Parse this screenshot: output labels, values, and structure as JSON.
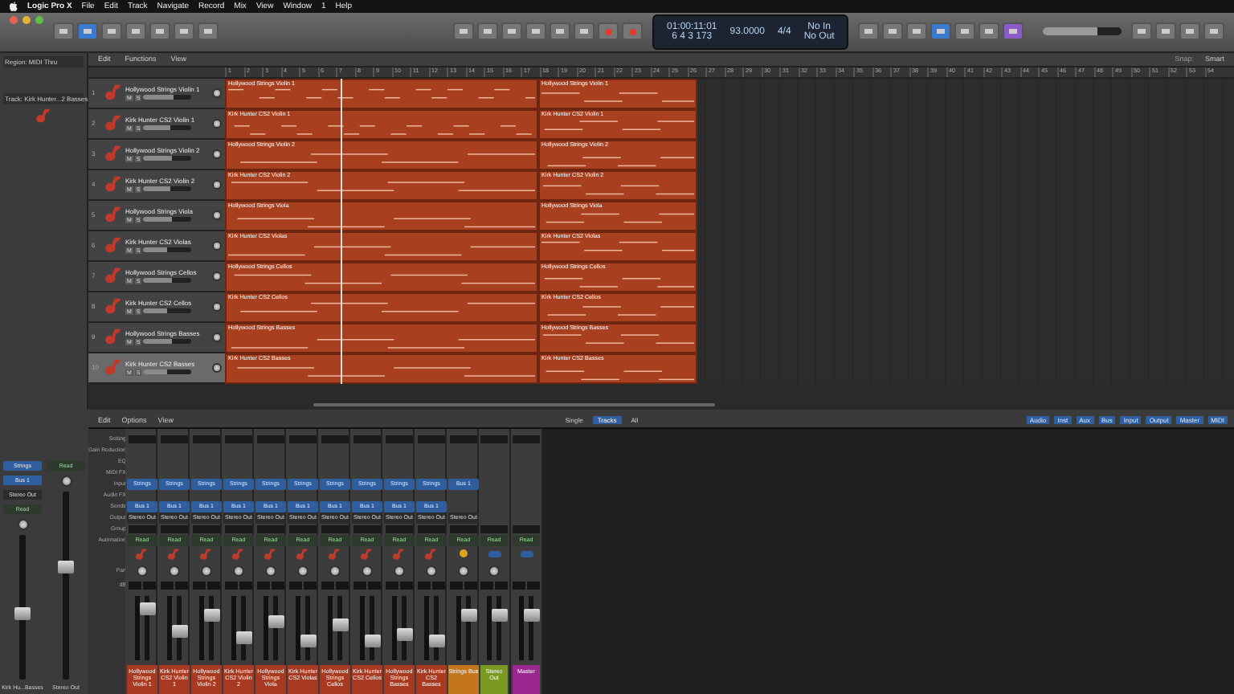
{
  "menu_bar": {
    "app": "Logic Pro X",
    "items": [
      "File",
      "Edit",
      "Track",
      "Navigate",
      "Record",
      "Mix",
      "View",
      "Window",
      "1",
      "Help"
    ]
  },
  "lcd": {
    "time": "01:00:11:01",
    "bars": "6 4 3 173",
    "tempo": "93.0000",
    "signature": "4/4",
    "in": "No In",
    "out": "No Out"
  },
  "control_bar": {
    "master_volume": {
      "level": 0.7
    }
  },
  "inspector": {
    "region_header": "Region: MIDI Thru",
    "track_header": "Track: Kirk Hunter...2 Basses"
  },
  "track_area": {
    "menus": [
      "Edit",
      "Functions",
      "View"
    ],
    "snap_label": "Snap:",
    "snap": "Smart",
    "ruler": [
      "1",
      "2",
      "3",
      "4",
      "5",
      "6",
      "7",
      "8",
      "9",
      "10",
      "11",
      "12",
      "13",
      "14",
      "15",
      "16",
      "17",
      "18",
      "19",
      "20",
      "21",
      "22",
      "23",
      "24",
      "25",
      "26",
      "27",
      "28",
      "29",
      "30",
      "31",
      "32",
      "33",
      "34",
      "35",
      "36",
      "37",
      "38",
      "39",
      "40",
      "41",
      "42",
      "43",
      "44",
      "45",
      "46",
      "47",
      "48",
      "49",
      "50",
      "51",
      "52",
      "53",
      "54"
    ],
    "playhead": {
      "level": 0.115
    }
  },
  "tracks": [
    {
      "number": "1",
      "mute_label": "M",
      "solo_label": "S",
      "name": "Hollywood Strings Violin 1",
      "selected": false,
      "level": 0.62,
      "regions": [
        "Hollywood Strings Violin 1",
        "Hollywood Strings Violin 1"
      ]
    },
    {
      "number": "2",
      "mute_label": "M",
      "solo_label": "S",
      "name": "Kirk Hunter CS2 Violin 1",
      "selected": false,
      "level": 0.55,
      "regions": [
        "Kirk Hunter CS2 Violin 1",
        "Kirk Hunter CS2 Violin 1"
      ]
    },
    {
      "number": "3",
      "mute_label": "M",
      "solo_label": "S",
      "name": "Hollywood Strings Violin 2",
      "selected": false,
      "level": 0.6,
      "regions": [
        "Hollywood Strings Violin 2",
        "Hollywood Strings Violin 2"
      ]
    },
    {
      "number": "4",
      "mute_label": "M",
      "solo_label": "S",
      "name": "Kirk Hunter CS2 Violin 2",
      "selected": false,
      "level": 0.55,
      "regions": [
        "Kirk Hunter CS2 Violin 2",
        "Kirk Hunter CS2 Violin 2"
      ]
    },
    {
      "number": "5",
      "mute_label": "M",
      "solo_label": "S",
      "name": "Hollywood Strings Viola",
      "selected": false,
      "level": 0.6,
      "regions": [
        "Hollywood Strings Viola",
        "Hollywood Strings Viola"
      ]
    },
    {
      "number": "6",
      "mute_label": "M",
      "solo_label": "S",
      "name": "Kirk Hunter CS2 Violas",
      "selected": false,
      "level": 0.5,
      "regions": [
        "Kirk Hunter CS2 Violas",
        "Kirk Hunter CS2 Violas"
      ]
    },
    {
      "number": "7",
      "mute_label": "M",
      "solo_label": "S",
      "name": "Hollywood Strings Cellos",
      "selected": false,
      "level": 0.6,
      "regions": [
        "Hollywood Strings Cellos",
        "Hollywood Strings Cellos"
      ]
    },
    {
      "number": "8",
      "mute_label": "M",
      "solo_label": "S",
      "name": "Kirk Hunter CS2 Cellos",
      "selected": false,
      "level": 0.5,
      "regions": [
        "Kirk Hunter CS2 Cellos",
        "Kirk Hunter CS2 Cellos"
      ]
    },
    {
      "number": "9",
      "mute_label": "M",
      "solo_label": "S",
      "name": "Hollywood Strings Basses",
      "selected": false,
      "level": 0.6,
      "regions": [
        "Hollywood Strings Basses",
        "Hollywood Strings Basses"
      ]
    },
    {
      "number": "10",
      "mute_label": "M",
      "solo_label": "S",
      "name": "Kirk Hunter CS2 Basses",
      "selected": true,
      "level": 0.5,
      "regions": [
        "Kirk Hunter CS2 Basses",
        "Kirk Hunter CS2 Basses"
      ]
    }
  ],
  "inspector_strips": [
    {
      "input": "Strings",
      "send": "Bus 1",
      "output": "Stereo Out",
      "automation": "Read",
      "level": 0.45,
      "name": "Kirk Hu...Basses"
    },
    {
      "automation": "Read",
      "level": 0.6,
      "name": "Stereo Out"
    }
  ],
  "mixer": {
    "menus": [
      "Edit",
      "Options",
      "View"
    ],
    "filters": [
      {
        "label": "Single",
        "selected": false
      },
      {
        "label": "Tracks",
        "selected": true
      },
      {
        "label": "All",
        "selected": false
      }
    ],
    "types": [
      "Audio",
      "Inst",
      "Aux",
      "Bus",
      "Input",
      "Output",
      "Master",
      "MIDI"
    ],
    "row_labels": [
      "Setting",
      "Gain Reduction",
      "EQ",
      "MIDI FX",
      "Input",
      "Audio FX",
      "Sends",
      "Output",
      "Group",
      "Automation",
      "Pan",
      "dB"
    ],
    "channels": [
      {
        "kind": "instrument",
        "input": "Strings",
        "send": "Bus 1",
        "output": "Stereo Out",
        "automation": "Read",
        "level": 0.8,
        "name": "Hollywood Strings Violin 1",
        "color": "#a83a22"
      },
      {
        "kind": "instrument",
        "input": "Strings",
        "send": "Bus 1",
        "output": "Stereo Out",
        "automation": "Read",
        "level": 0.45,
        "name": "Kirk Hunter CS2 Violin 1",
        "color": "#a83a22"
      },
      {
        "kind": "instrument",
        "input": "Strings",
        "send": "Bus 1",
        "output": "Stereo Out",
        "automation": "Read",
        "level": 0.7,
        "name": "Hollywood Strings Violin 2",
        "color": "#a83a22"
      },
      {
        "kind": "instrument",
        "input": "Strings",
        "send": "Bus 1",
        "output": "Stereo Out",
        "automation": "Read",
        "level": 0.35,
        "name": "Kirk Hunter CS2 Violin 2",
        "color": "#a83a22"
      },
      {
        "kind": "instrument",
        "input": "Strings",
        "send": "Bus 1",
        "output": "Stereo Out",
        "automation": "Read",
        "level": 0.6,
        "name": "Hollywood Strings Viola",
        "color": "#a83a22"
      },
      {
        "kind": "instrument",
        "input": "Strings",
        "send": "Bus 1",
        "output": "Stereo Out",
        "automation": "Read",
        "level": 0.3,
        "name": "Kirk Hunter CS2 Violas",
        "color": "#a83a22"
      },
      {
        "kind": "instrument",
        "input": "Strings",
        "send": "Bus 1",
        "output": "Stereo Out",
        "automation": "Read",
        "level": 0.55,
        "name": "Hollywood Strings Cellos",
        "color": "#a83a22"
      },
      {
        "kind": "instrument",
        "input": "Strings",
        "send": "Bus 1",
        "output": "Stereo Out",
        "automation": "Read",
        "level": 0.3,
        "name": "Kirk Hunter CS2 Cellos",
        "color": "#a83a22"
      },
      {
        "kind": "instrument",
        "input": "Strings",
        "send": "Bus 1",
        "output": "Stereo Out",
        "automation": "Read",
        "level": 0.4,
        "name": "Hollywood Strings Basses",
        "color": "#a83a22"
      },
      {
        "kind": "instrument",
        "input": "Strings",
        "send": "Bus 1",
        "output": "Stereo Out",
        "automation": "Read",
        "level": 0.3,
        "name": "Kirk Hunter CS2 Basses",
        "color": "#a83a22"
      },
      {
        "kind": "aux",
        "input": "Bus 1",
        "output": "Stereo Out",
        "automation": "Read",
        "level": 0.7,
        "name": "Strings Bus",
        "color": "#c4761c"
      },
      {
        "kind": "output",
        "automation": "Read",
        "level": 0.7,
        "name": "Stereo Out",
        "color": "#7b9a22"
      },
      {
        "kind": "master",
        "automation": "Read",
        "level": 0.7,
        "name": "Master",
        "color": "#9c2690"
      }
    ]
  }
}
